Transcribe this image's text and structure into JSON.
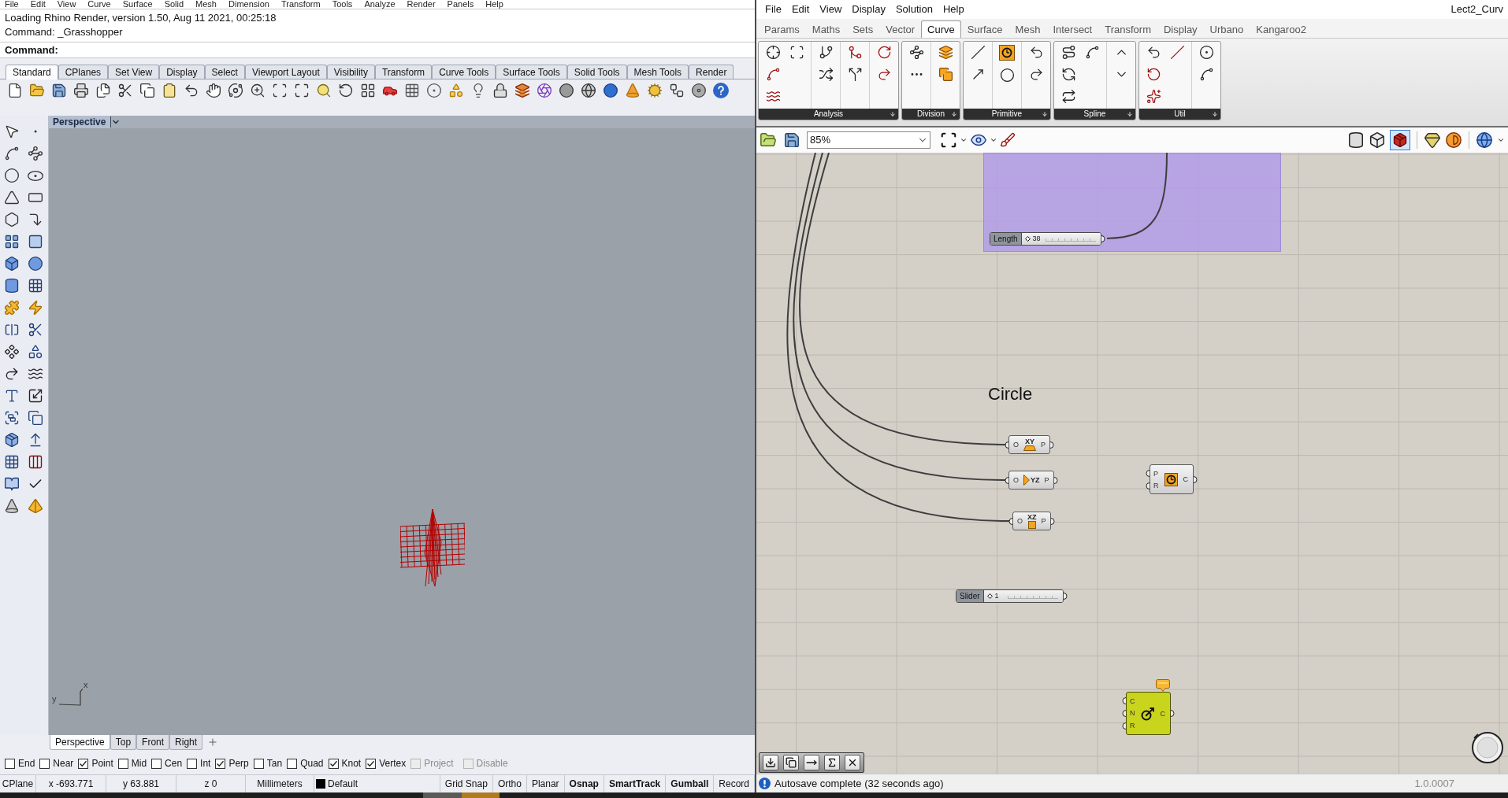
{
  "rhino": {
    "menu": [
      "File",
      "Edit",
      "View",
      "Curve",
      "Surface",
      "Solid",
      "Mesh",
      "Dimension",
      "Transform",
      "Tools",
      "Analyze",
      "Render",
      "Panels",
      "Help"
    ],
    "command_history": [
      "Loading Rhino Render, version 1.50, Aug 11 2021, 00:25:18",
      "Command: _Grasshopper"
    ],
    "command_prompt": "Command:",
    "toolbar_tabs": [
      {
        "label": "Standard",
        "selected": true
      },
      {
        "label": "CPlanes",
        "selected": false
      },
      {
        "label": "Set View",
        "selected": false
      },
      {
        "label": "Display",
        "selected": false
      },
      {
        "label": "Select",
        "selected": false
      },
      {
        "label": "Viewport Layout",
        "selected": false
      },
      {
        "label": "Visibility",
        "selected": false
      },
      {
        "label": "Transform",
        "selected": false
      },
      {
        "label": "Curve Tools",
        "selected": false
      },
      {
        "label": "Surface Tools",
        "selected": false
      },
      {
        "label": "Solid Tools",
        "selected": false
      },
      {
        "label": "Mesh Tools",
        "selected": false
      },
      {
        "label": "Render",
        "selected": false
      }
    ],
    "viewport": {
      "title": "Perspective",
      "axis_labels": [
        "y",
        "x"
      ]
    },
    "viewport_tabs": [
      {
        "label": "Perspective",
        "selected": true
      },
      {
        "label": "Top",
        "selected": false
      },
      {
        "label": "Front",
        "selected": false
      },
      {
        "label": "Right",
        "selected": false
      }
    ],
    "osnaps": [
      {
        "label": "End",
        "checked": false,
        "disabled": false
      },
      {
        "label": "Near",
        "checked": false,
        "disabled": false
      },
      {
        "label": "Point",
        "checked": true,
        "disabled": false
      },
      {
        "label": "Mid",
        "checked": false,
        "disabled": false
      },
      {
        "label": "Cen",
        "checked": false,
        "disabled": false
      },
      {
        "label": "Int",
        "checked": false,
        "disabled": false
      },
      {
        "label": "Perp",
        "checked": true,
        "disabled": false
      },
      {
        "label": "Tan",
        "checked": false,
        "disabled": false
      },
      {
        "label": "Quad",
        "checked": false,
        "disabled": false
      },
      {
        "label": "Knot",
        "checked": true,
        "disabled": false
      },
      {
        "label": "Vertex",
        "checked": true,
        "disabled": false
      },
      {
        "label": "Project",
        "checked": false,
        "disabled": true
      }
    ],
    "osnap_disable": {
      "label": "Disable",
      "checked": false,
      "disabled": true
    },
    "status_bar": [
      {
        "kind": "cell",
        "text": "CPlane"
      },
      {
        "kind": "cell",
        "text": "x -693.771"
      },
      {
        "kind": "cell",
        "text": "y 63.881"
      },
      {
        "kind": "cell",
        "text": "z 0"
      },
      {
        "kind": "cell",
        "text": "Millimeters"
      },
      {
        "kind": "layer",
        "text": "Default",
        "color": "#000000"
      },
      {
        "kind": "toggle",
        "text": "Grid Snap",
        "on": false
      },
      {
        "kind": "toggle",
        "text": "Ortho",
        "on": false
      },
      {
        "kind": "toggle",
        "text": "Planar",
        "on": false
      },
      {
        "kind": "toggle",
        "text": "Osnap",
        "on": true
      },
      {
        "kind": "toggle",
        "text": "SmartTrack",
        "on": true
      },
      {
        "kind": "toggle",
        "text": "Gumball",
        "on": true
      },
      {
        "kind": "toggle",
        "text": "Record",
        "on": false
      }
    ]
  },
  "grasshopper": {
    "menu": [
      "File",
      "Edit",
      "View",
      "Display",
      "Solution",
      "Help"
    ],
    "document_title": "Lect2_Curv",
    "tabs": [
      {
        "label": "Params",
        "selected": false
      },
      {
        "label": "Maths",
        "selected": false
      },
      {
        "label": "Sets",
        "selected": false
      },
      {
        "label": "Vector",
        "selected": false
      },
      {
        "label": "Curve",
        "selected": true
      },
      {
        "label": "Surface",
        "selected": false
      },
      {
        "label": "Mesh",
        "selected": false
      },
      {
        "label": "Intersect",
        "selected": false
      },
      {
        "label": "Transform",
        "selected": false
      },
      {
        "label": "Display",
        "selected": false
      },
      {
        "label": "Urbano",
        "selected": false
      },
      {
        "label": "Kangaroo2",
        "selected": false
      }
    ],
    "panels": [
      "Analysis",
      "Division",
      "Primitive",
      "Spline",
      "Util"
    ],
    "zoom": "85%",
    "canvas": {
      "scribble": "Circle",
      "sliders": [
        {
          "label": "Length",
          "value": "38",
          "level": 0
        },
        {
          "label": "Slider",
          "value": "1",
          "level": 0
        }
      ],
      "planes": [
        {
          "kind": "xy",
          "input": "O",
          "label": "XY",
          "output": "P"
        },
        {
          "kind": "yz",
          "input": "O",
          "label": "YZ",
          "output": "P"
        },
        {
          "kind": "xz",
          "input": "O",
          "label": "XZ",
          "output": "P"
        }
      ],
      "components": [
        {
          "kind": "circle_pr",
          "inputs": [
            "P",
            "R"
          ],
          "output": "C",
          "selected": false,
          "warning": false
        },
        {
          "kind": "circle_cnr",
          "inputs": [
            "C",
            "N",
            "R"
          ],
          "output": "C",
          "selected": true,
          "warning": true
        }
      ]
    },
    "status": {
      "message": "Autosave complete (32 seconds ago)",
      "version": "1.0.0007"
    }
  }
}
